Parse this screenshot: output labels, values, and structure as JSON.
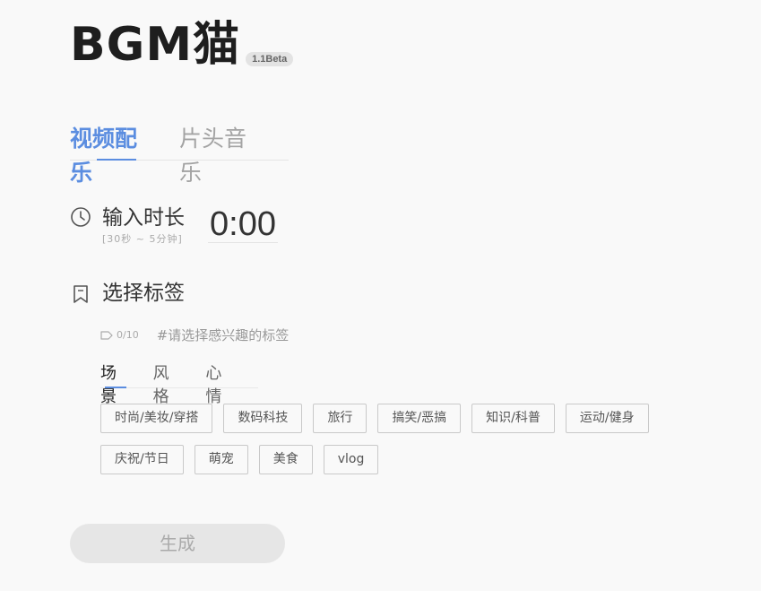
{
  "app": {
    "logo": "BGM猫",
    "version": "1.1Beta"
  },
  "main_tabs": [
    {
      "label": "视频配乐",
      "active": true
    },
    {
      "label": "片头音乐",
      "active": false
    }
  ],
  "duration": {
    "icon": "clock-icon",
    "label": "输入时长",
    "hint": "[30秒 ~ 5分钟]",
    "value": "0:00"
  },
  "tags": {
    "icon": "bookmark-icon",
    "title": "选择标签",
    "tag_icon": "tag-icon",
    "count": "0/10",
    "hint": "#请选择感兴趣的标签",
    "sub_tabs": [
      {
        "label": "场景",
        "active": true
      },
      {
        "label": "风格",
        "active": false
      },
      {
        "label": "心情",
        "active": false
      }
    ],
    "chips_row1": [
      "时尚/美妆/穿搭",
      "数码科技",
      "旅行",
      "搞笑/恶搞",
      "知识/科普",
      "运动/健身"
    ],
    "chips_row2": [
      "庆祝/节日",
      "萌宠",
      "美食",
      "vlog"
    ]
  },
  "generate_button": {
    "label": "生成",
    "enabled": false
  },
  "colors": {
    "accent": "#5b8de0",
    "background": "#f9f9f9",
    "disabled_button": "#e6e6e6"
  }
}
